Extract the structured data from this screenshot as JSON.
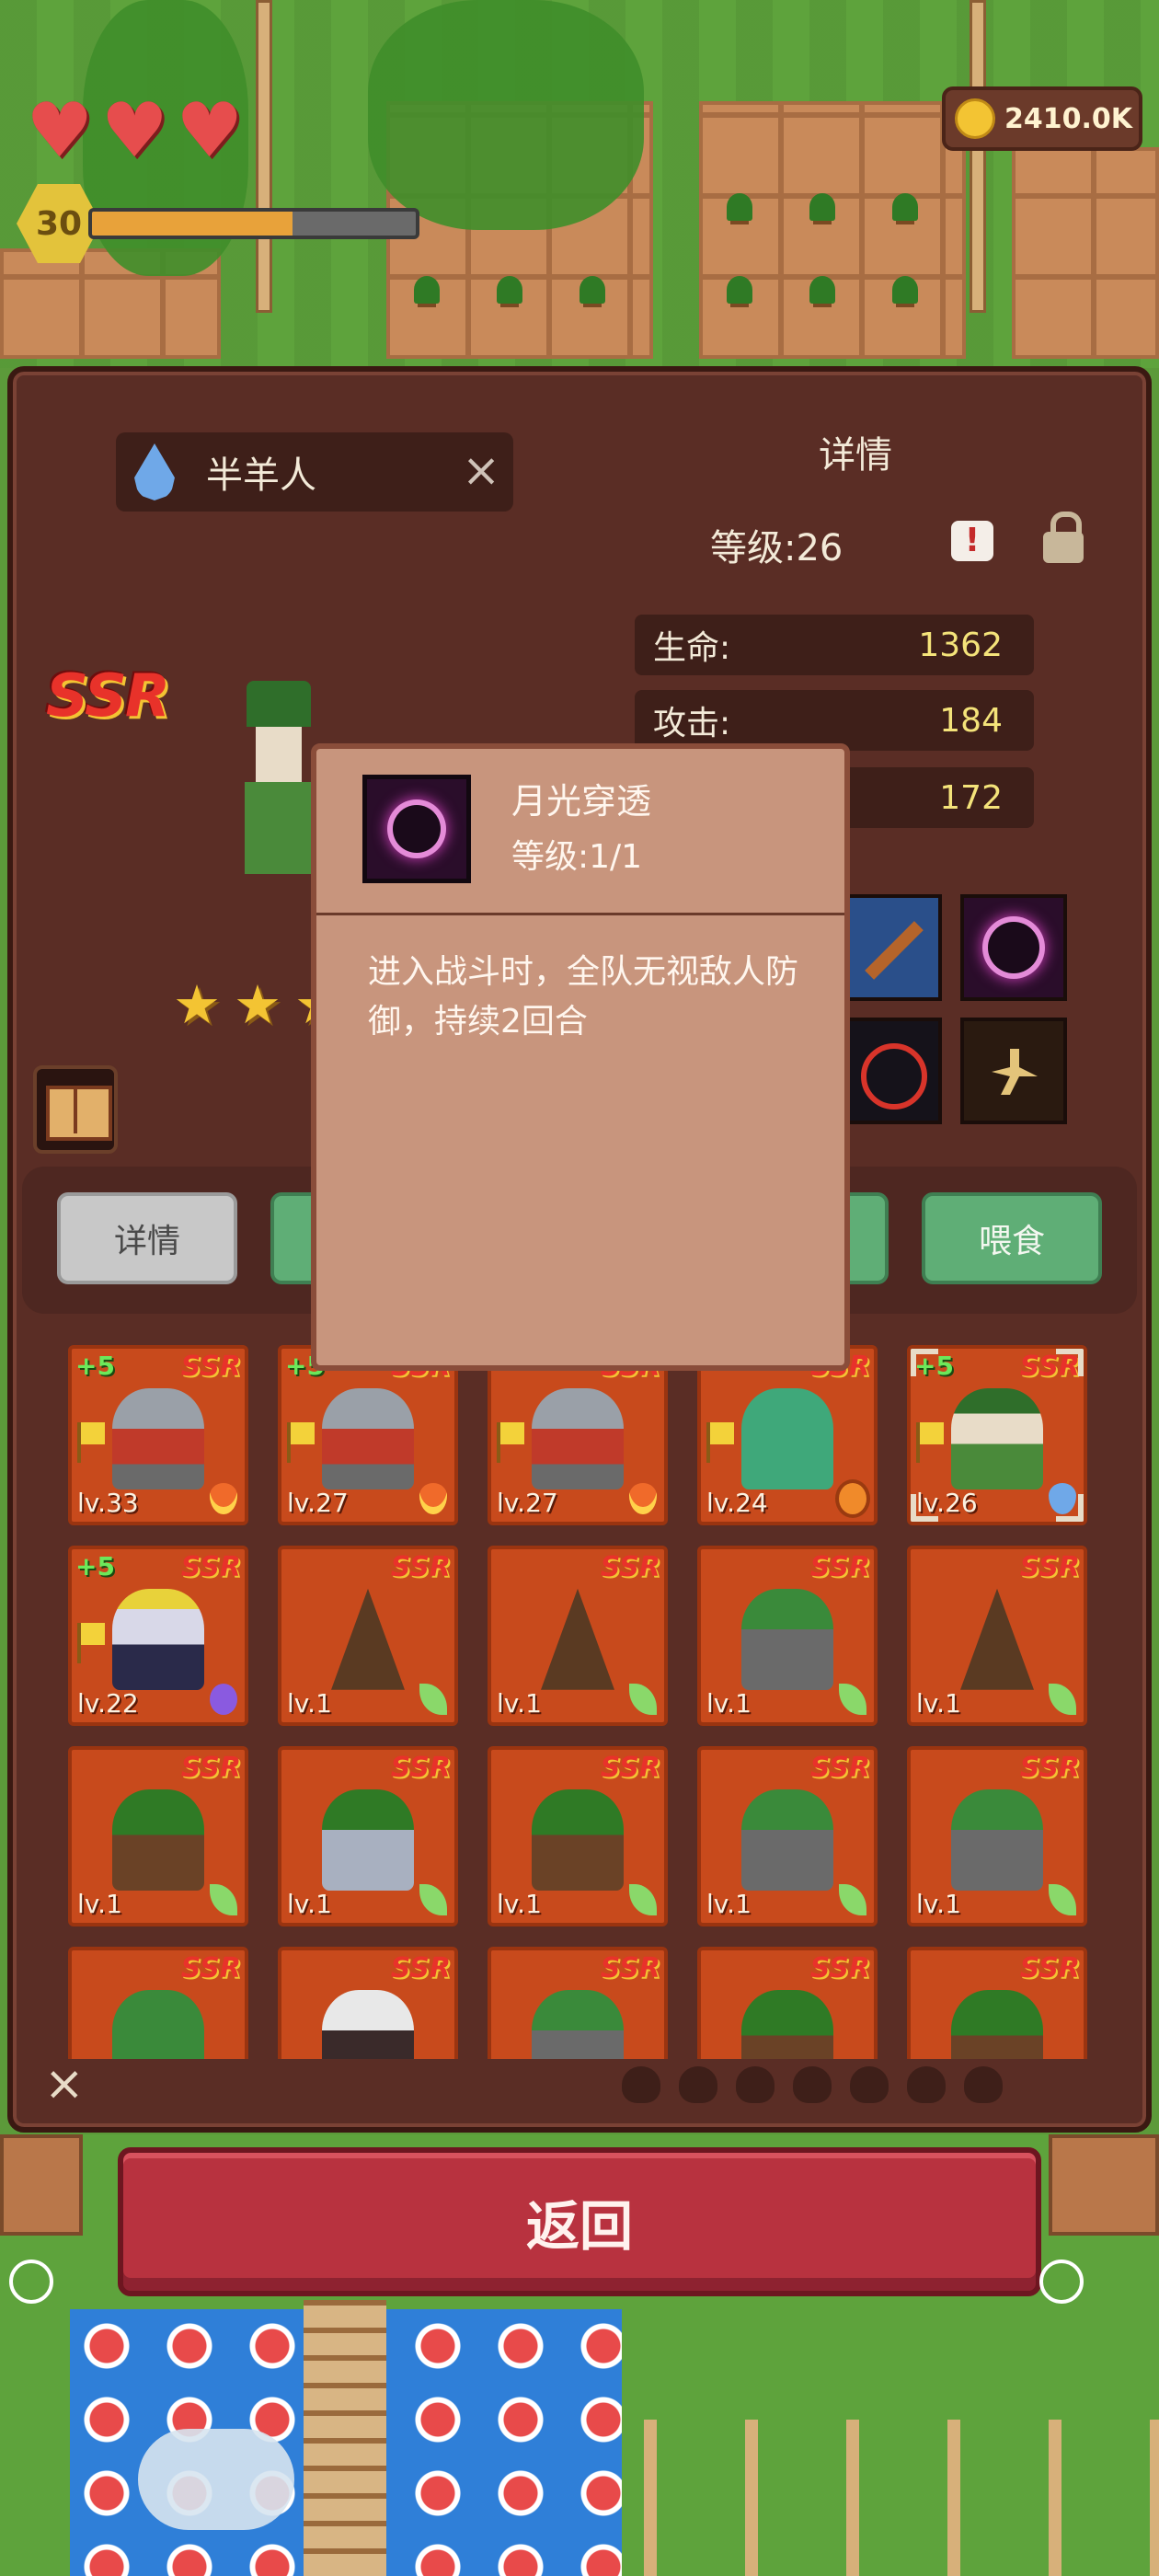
{
  "hud": {
    "hearts": 3,
    "player_level": "30",
    "xp_fraction": 0.62,
    "coins": "2410.0K"
  },
  "panel": {
    "unit_name": "半羊人",
    "unit_element_icon": "water-drop-icon",
    "detail_title": "详情",
    "level_text": "等级:26",
    "rarity": "SSR",
    "stars": 3,
    "stats": [
      {
        "label": "生命:",
        "value": "1362"
      },
      {
        "label": "攻击:",
        "value": "184"
      },
      {
        "label": "",
        "value": "172"
      }
    ],
    "skills": [
      "staff-icon",
      "moon-orb-icon",
      "crosshair-icon",
      "dash-icon"
    ],
    "tabs": {
      "detail": "详情",
      "feed": "喂食"
    }
  },
  "tooltip": {
    "skill_name": "月光穿透",
    "skill_level": "等级:1/1",
    "description": "进入战斗时，全队无视敌人防御，持续2回合"
  },
  "cards": [
    {
      "level": "lv.33",
      "plus": "+5",
      "flag": true,
      "sprite": "knight",
      "element": "fire"
    },
    {
      "level": "lv.27",
      "plus": "+5",
      "flag": true,
      "sprite": "knight",
      "element": "fire"
    },
    {
      "level": "lv.27",
      "plus": "",
      "flag": true,
      "sprite": "knight",
      "element": "fire"
    },
    {
      "level": "lv.24",
      "plus": "",
      "flag": true,
      "sprite": "slime",
      "element": "earth"
    },
    {
      "level": "lv.26",
      "plus": "+5",
      "flag": true,
      "sprite": "elf",
      "element": "water",
      "selected": true
    },
    {
      "level": "lv.22",
      "plus": "+5",
      "flag": true,
      "sprite": "lich",
      "element": "dark"
    },
    {
      "level": "lv.1",
      "plus": "",
      "flag": false,
      "sprite": "tree",
      "element": "leaf"
    },
    {
      "level": "lv.1",
      "plus": "",
      "flag": false,
      "sprite": "tree",
      "element": "leaf"
    },
    {
      "level": "lv.1",
      "plus": "",
      "flag": false,
      "sprite": "orc",
      "element": "leaf"
    },
    {
      "level": "lv.1",
      "plus": "",
      "flag": false,
      "sprite": "tree",
      "element": "leaf"
    },
    {
      "level": "lv.1",
      "plus": "",
      "flag": false,
      "sprite": "ent",
      "element": "leaf"
    },
    {
      "level": "lv.1",
      "plus": "",
      "flag": false,
      "sprite": "rider",
      "element": "leaf"
    },
    {
      "level": "lv.1",
      "plus": "",
      "flag": false,
      "sprite": "ent",
      "element": "leaf"
    },
    {
      "level": "lv.1",
      "plus": "",
      "flag": false,
      "sprite": "orc",
      "element": "leaf"
    },
    {
      "level": "lv.1",
      "plus": "",
      "flag": false,
      "sprite": "orc",
      "element": "leaf"
    },
    {
      "level": "",
      "plus": "",
      "flag": false,
      "sprite": "goblin",
      "element": ""
    },
    {
      "level": "",
      "plus": "",
      "flag": false,
      "sprite": "skel",
      "element": ""
    },
    {
      "level": "",
      "plus": "",
      "flag": false,
      "sprite": "orc",
      "element": ""
    },
    {
      "level": "",
      "plus": "",
      "flag": false,
      "sprite": "ent",
      "element": ""
    },
    {
      "level": "",
      "plus": "",
      "flag": false,
      "sprite": "ent",
      "element": ""
    }
  ],
  "back_button": "返回"
}
